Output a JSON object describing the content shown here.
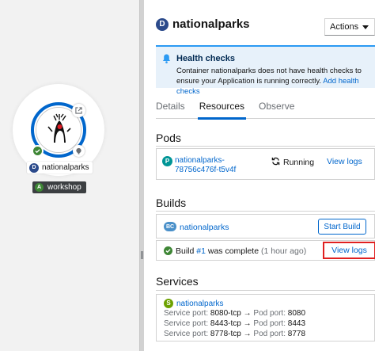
{
  "topology": {
    "node_name": "nationalparks",
    "node_kind": "D",
    "application_name": "workshop",
    "application_kind": "A"
  },
  "panel": {
    "resource_kind": "D",
    "title": "nationalparks",
    "actions_label": "Actions"
  },
  "alert": {
    "title": "Health checks",
    "body": "Container nationalparks does not have health checks to ensure your Application is running correctly.",
    "link": "Add health checks"
  },
  "tabs": [
    {
      "label": "Details",
      "active": false
    },
    {
      "label": "Resources",
      "active": true
    },
    {
      "label": "Observe",
      "active": false
    }
  ],
  "pods": {
    "title": "Pods",
    "kind": "P",
    "name_line1": "nationalparks-",
    "name_line2": "78756c476f-t5v4f",
    "status": "Running",
    "logs_label": "View logs"
  },
  "builds": {
    "title": "Builds",
    "bc_kind": "BC",
    "bc_name": "nationalparks",
    "start_label": "Start Build",
    "build_prefix": "Build ",
    "build_number": "#1",
    "build_suffix": " was complete ",
    "build_time": "(1 hour ago)",
    "logs_label": "View logs"
  },
  "services": {
    "title": "Services",
    "kind": "S",
    "name": "nationalparks",
    "service_port_label": "Service port:",
    "pod_port_label": "Pod port:",
    "rows": [
      {
        "service_port": "8080-tcp",
        "pod_port": "8080"
      },
      {
        "service_port": "8443-tcp",
        "pod_port": "8443"
      },
      {
        "service_port": "8778-tcp",
        "pod_port": "8778"
      }
    ]
  },
  "colors": {
    "link": "#0066cc",
    "success": "#3e8635",
    "alert_bg": "#e7f1fa",
    "highlight": "#e02020"
  },
  "icons": [
    "external-link-icon",
    "success-check-icon",
    "github-icon",
    "java-duke-icon",
    "bell-icon",
    "caret-down-icon",
    "sync-icon",
    "drag-handle-icon"
  ]
}
